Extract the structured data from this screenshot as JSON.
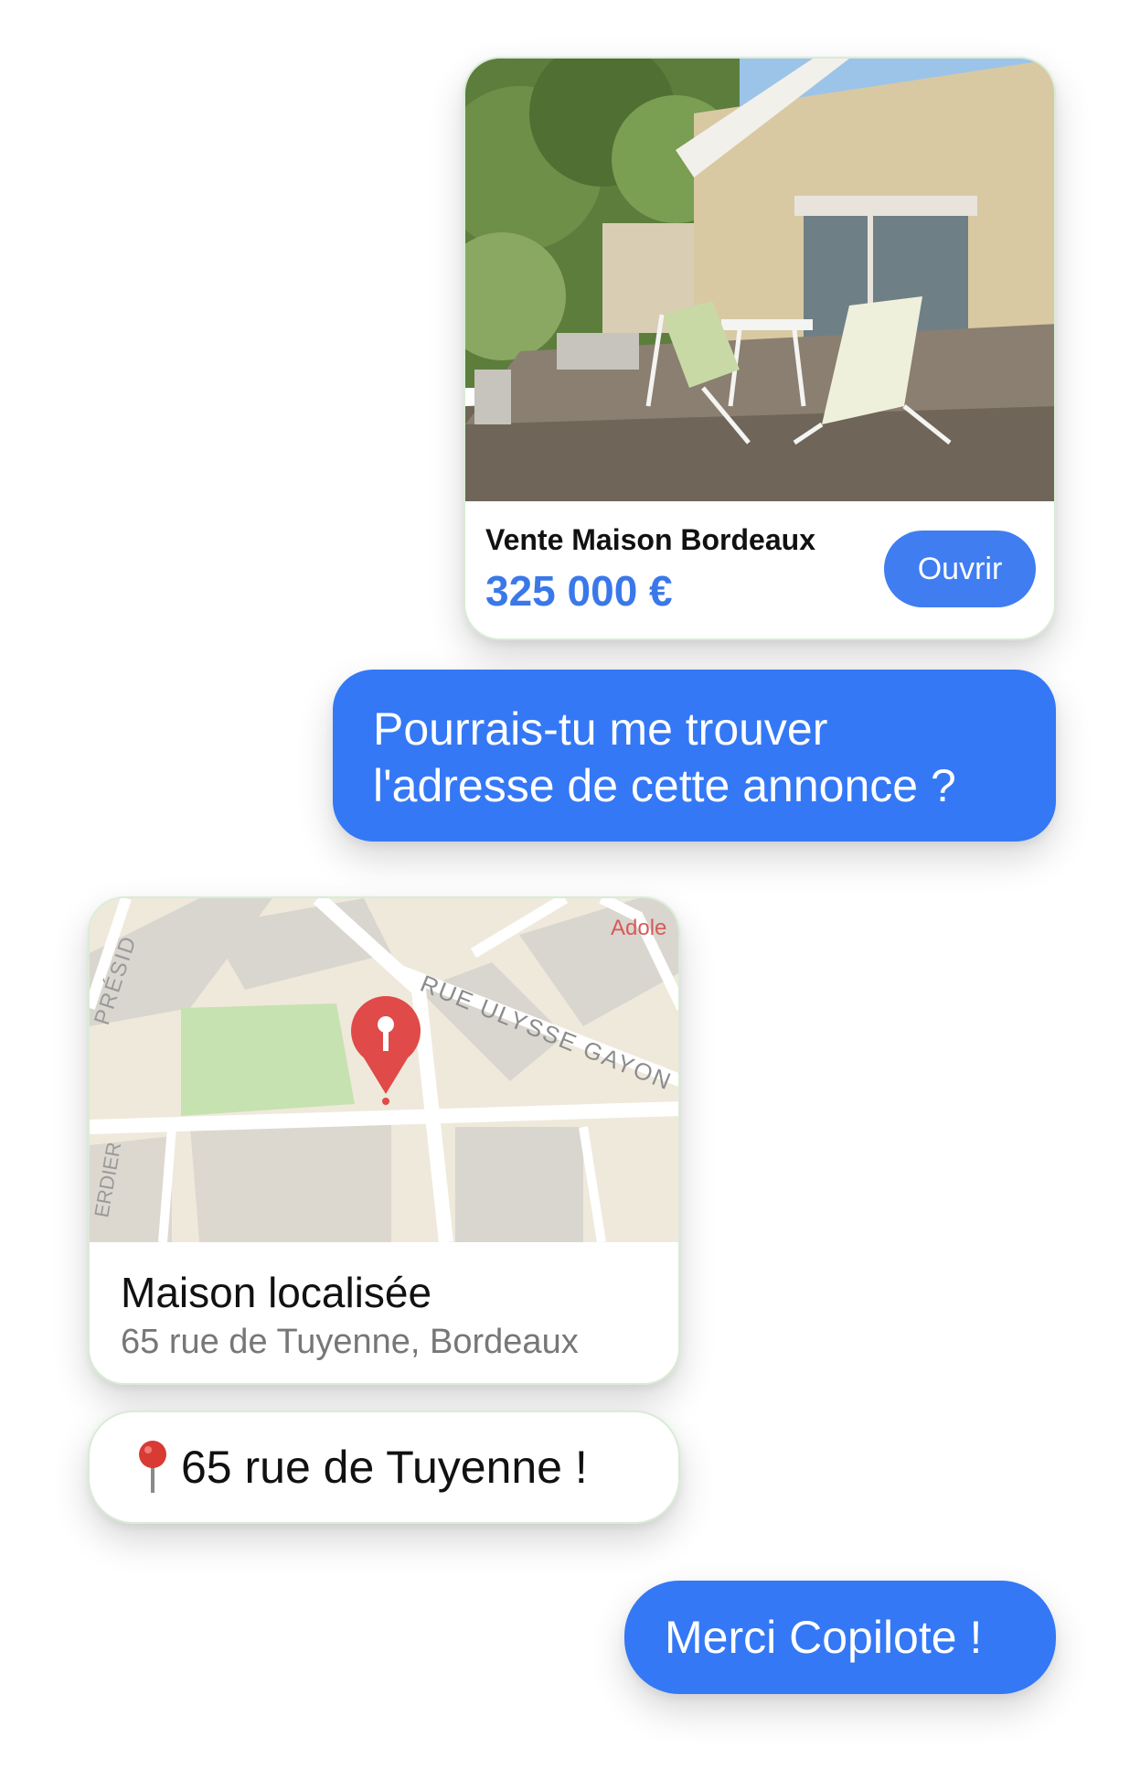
{
  "listing": {
    "title": "Vente Maison Bordeaux",
    "price": "325 000 €",
    "open_label": "Ouvrir"
  },
  "messages": {
    "question_line1": "Pourrais-tu me trouver",
    "question_line2": "l'adresse de cette annonce ?",
    "reply": "65 rue de Tuyenne !",
    "thanks": "Merci Copilote !"
  },
  "map": {
    "title": "Maison localisée",
    "address": "65 rue de Tuyenne, Bordeaux",
    "street_labels": [
      "RUE ULYSSE GAYON",
      "PRÉSID",
      "ERDIER",
      "Adole"
    ],
    "pin_icon": "map-pin-icon"
  },
  "colors": {
    "accent_blue": "#3478f6",
    "price_blue": "#3a78ea",
    "pin_red": "#e04a48",
    "map_park": "#c6e2b0",
    "map_land": "#efe9dc"
  }
}
